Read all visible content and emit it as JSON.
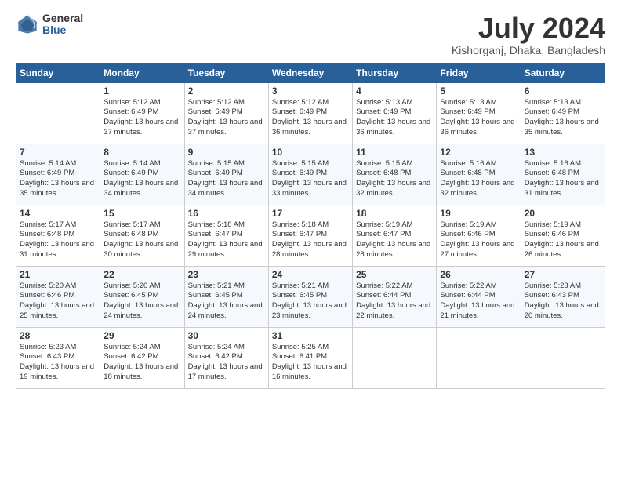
{
  "logo": {
    "general": "General",
    "blue": "Blue"
  },
  "title": "July 2024",
  "subtitle": "Kishorganj, Dhaka, Bangladesh",
  "days_of_week": [
    "Sunday",
    "Monday",
    "Tuesday",
    "Wednesday",
    "Thursday",
    "Friday",
    "Saturday"
  ],
  "weeks": [
    [
      {
        "num": "",
        "sunrise": "",
        "sunset": "",
        "daylight": ""
      },
      {
        "num": "1",
        "sunrise": "Sunrise: 5:12 AM",
        "sunset": "Sunset: 6:49 PM",
        "daylight": "Daylight: 13 hours and 37 minutes."
      },
      {
        "num": "2",
        "sunrise": "Sunrise: 5:12 AM",
        "sunset": "Sunset: 6:49 PM",
        "daylight": "Daylight: 13 hours and 37 minutes."
      },
      {
        "num": "3",
        "sunrise": "Sunrise: 5:12 AM",
        "sunset": "Sunset: 6:49 PM",
        "daylight": "Daylight: 13 hours and 36 minutes."
      },
      {
        "num": "4",
        "sunrise": "Sunrise: 5:13 AM",
        "sunset": "Sunset: 6:49 PM",
        "daylight": "Daylight: 13 hours and 36 minutes."
      },
      {
        "num": "5",
        "sunrise": "Sunrise: 5:13 AM",
        "sunset": "Sunset: 6:49 PM",
        "daylight": "Daylight: 13 hours and 36 minutes."
      },
      {
        "num": "6",
        "sunrise": "Sunrise: 5:13 AM",
        "sunset": "Sunset: 6:49 PM",
        "daylight": "Daylight: 13 hours and 35 minutes."
      }
    ],
    [
      {
        "num": "7",
        "sunrise": "Sunrise: 5:14 AM",
        "sunset": "Sunset: 6:49 PM",
        "daylight": "Daylight: 13 hours and 35 minutes."
      },
      {
        "num": "8",
        "sunrise": "Sunrise: 5:14 AM",
        "sunset": "Sunset: 6:49 PM",
        "daylight": "Daylight: 13 hours and 34 minutes."
      },
      {
        "num": "9",
        "sunrise": "Sunrise: 5:15 AM",
        "sunset": "Sunset: 6:49 PM",
        "daylight": "Daylight: 13 hours and 34 minutes."
      },
      {
        "num": "10",
        "sunrise": "Sunrise: 5:15 AM",
        "sunset": "Sunset: 6:49 PM",
        "daylight": "Daylight: 13 hours and 33 minutes."
      },
      {
        "num": "11",
        "sunrise": "Sunrise: 5:15 AM",
        "sunset": "Sunset: 6:48 PM",
        "daylight": "Daylight: 13 hours and 32 minutes."
      },
      {
        "num": "12",
        "sunrise": "Sunrise: 5:16 AM",
        "sunset": "Sunset: 6:48 PM",
        "daylight": "Daylight: 13 hours and 32 minutes."
      },
      {
        "num": "13",
        "sunrise": "Sunrise: 5:16 AM",
        "sunset": "Sunset: 6:48 PM",
        "daylight": "Daylight: 13 hours and 31 minutes."
      }
    ],
    [
      {
        "num": "14",
        "sunrise": "Sunrise: 5:17 AM",
        "sunset": "Sunset: 6:48 PM",
        "daylight": "Daylight: 13 hours and 31 minutes."
      },
      {
        "num": "15",
        "sunrise": "Sunrise: 5:17 AM",
        "sunset": "Sunset: 6:48 PM",
        "daylight": "Daylight: 13 hours and 30 minutes."
      },
      {
        "num": "16",
        "sunrise": "Sunrise: 5:18 AM",
        "sunset": "Sunset: 6:47 PM",
        "daylight": "Daylight: 13 hours and 29 minutes."
      },
      {
        "num": "17",
        "sunrise": "Sunrise: 5:18 AM",
        "sunset": "Sunset: 6:47 PM",
        "daylight": "Daylight: 13 hours and 28 minutes."
      },
      {
        "num": "18",
        "sunrise": "Sunrise: 5:19 AM",
        "sunset": "Sunset: 6:47 PM",
        "daylight": "Daylight: 13 hours and 28 minutes."
      },
      {
        "num": "19",
        "sunrise": "Sunrise: 5:19 AM",
        "sunset": "Sunset: 6:46 PM",
        "daylight": "Daylight: 13 hours and 27 minutes."
      },
      {
        "num": "20",
        "sunrise": "Sunrise: 5:19 AM",
        "sunset": "Sunset: 6:46 PM",
        "daylight": "Daylight: 13 hours and 26 minutes."
      }
    ],
    [
      {
        "num": "21",
        "sunrise": "Sunrise: 5:20 AM",
        "sunset": "Sunset: 6:46 PM",
        "daylight": "Daylight: 13 hours and 25 minutes."
      },
      {
        "num": "22",
        "sunrise": "Sunrise: 5:20 AM",
        "sunset": "Sunset: 6:45 PM",
        "daylight": "Daylight: 13 hours and 24 minutes."
      },
      {
        "num": "23",
        "sunrise": "Sunrise: 5:21 AM",
        "sunset": "Sunset: 6:45 PM",
        "daylight": "Daylight: 13 hours and 24 minutes."
      },
      {
        "num": "24",
        "sunrise": "Sunrise: 5:21 AM",
        "sunset": "Sunset: 6:45 PM",
        "daylight": "Daylight: 13 hours and 23 minutes."
      },
      {
        "num": "25",
        "sunrise": "Sunrise: 5:22 AM",
        "sunset": "Sunset: 6:44 PM",
        "daylight": "Daylight: 13 hours and 22 minutes."
      },
      {
        "num": "26",
        "sunrise": "Sunrise: 5:22 AM",
        "sunset": "Sunset: 6:44 PM",
        "daylight": "Daylight: 13 hours and 21 minutes."
      },
      {
        "num": "27",
        "sunrise": "Sunrise: 5:23 AM",
        "sunset": "Sunset: 6:43 PM",
        "daylight": "Daylight: 13 hours and 20 minutes."
      }
    ],
    [
      {
        "num": "28",
        "sunrise": "Sunrise: 5:23 AM",
        "sunset": "Sunset: 6:43 PM",
        "daylight": "Daylight: 13 hours and 19 minutes."
      },
      {
        "num": "29",
        "sunrise": "Sunrise: 5:24 AM",
        "sunset": "Sunset: 6:42 PM",
        "daylight": "Daylight: 13 hours and 18 minutes."
      },
      {
        "num": "30",
        "sunrise": "Sunrise: 5:24 AM",
        "sunset": "Sunset: 6:42 PM",
        "daylight": "Daylight: 13 hours and 17 minutes."
      },
      {
        "num": "31",
        "sunrise": "Sunrise: 5:25 AM",
        "sunset": "Sunset: 6:41 PM",
        "daylight": "Daylight: 13 hours and 16 minutes."
      },
      {
        "num": "",
        "sunrise": "",
        "sunset": "",
        "daylight": ""
      },
      {
        "num": "",
        "sunrise": "",
        "sunset": "",
        "daylight": ""
      },
      {
        "num": "",
        "sunrise": "",
        "sunset": "",
        "daylight": ""
      }
    ]
  ]
}
